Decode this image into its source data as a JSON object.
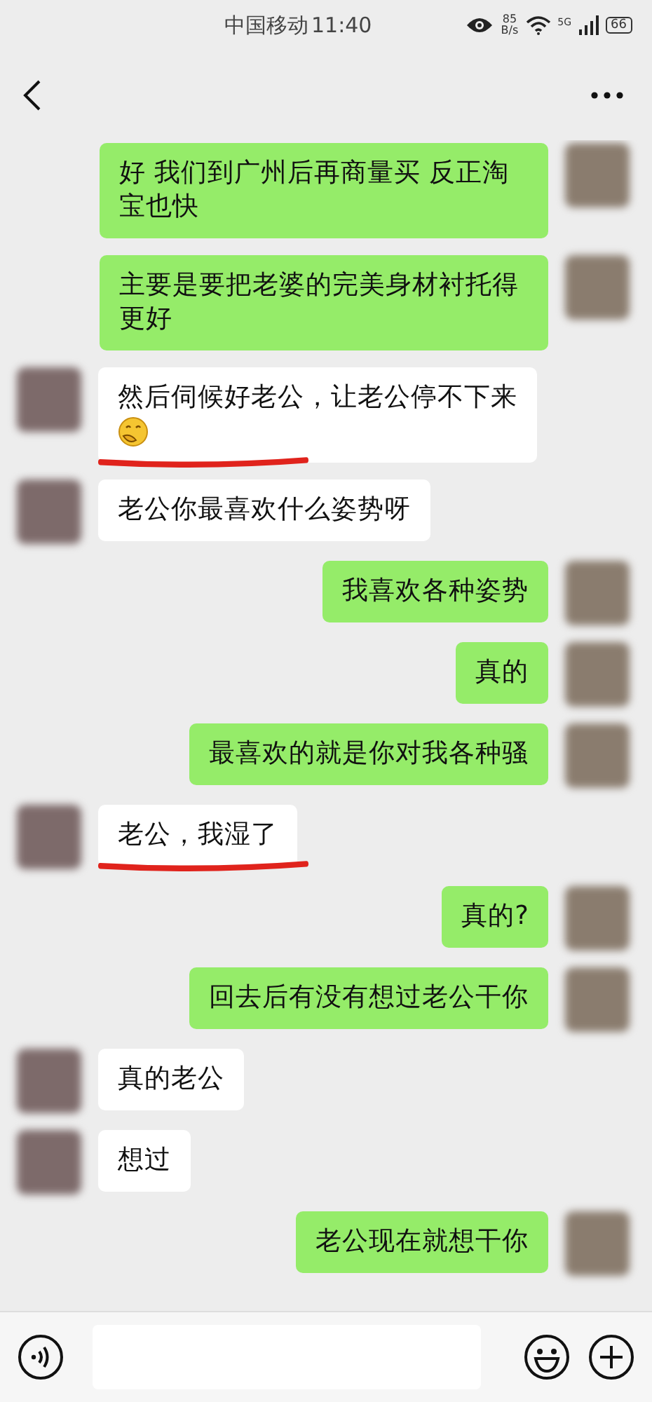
{
  "status_bar": {
    "carrier": "中国移动",
    "time": "11:40",
    "net_speed_value": "85",
    "net_speed_unit": "B/s",
    "network": "5G",
    "battery": "66"
  },
  "messages": [
    {
      "kind": "out",
      "text": "好 我们到广州后再商量买 反正淘宝也快",
      "emoji": false,
      "underlined": false
    },
    {
      "kind": "out",
      "text": "主要是要把老婆的完美身材衬托得更好",
      "emoji": false,
      "underlined": false
    },
    {
      "kind": "in",
      "text": "然后伺候好老公，让老公停不下来",
      "emoji": true,
      "underlined": true
    },
    {
      "kind": "in",
      "text": "老公你最喜欢什么姿势呀",
      "emoji": false,
      "underlined": false
    },
    {
      "kind": "out",
      "text": "我喜欢各种姿势",
      "emoji": false,
      "underlined": false
    },
    {
      "kind": "out",
      "text": "真的",
      "emoji": false,
      "underlined": false
    },
    {
      "kind": "out",
      "text": "最喜欢的就是你对我各种骚",
      "emoji": false,
      "underlined": false
    },
    {
      "kind": "in",
      "text": "老公，我湿了",
      "emoji": false,
      "underlined": true
    },
    {
      "kind": "out",
      "text": "真的?",
      "emoji": false,
      "underlined": false
    },
    {
      "kind": "out",
      "text": "回去后有没有想过老公干你",
      "emoji": false,
      "underlined": false
    },
    {
      "kind": "in",
      "text": "真的老公",
      "emoji": false,
      "underlined": false
    },
    {
      "kind": "in",
      "text": "想过",
      "emoji": false,
      "underlined": false
    },
    {
      "kind": "out",
      "text": "老公现在就想干你",
      "emoji": false,
      "underlined": false
    }
  ]
}
